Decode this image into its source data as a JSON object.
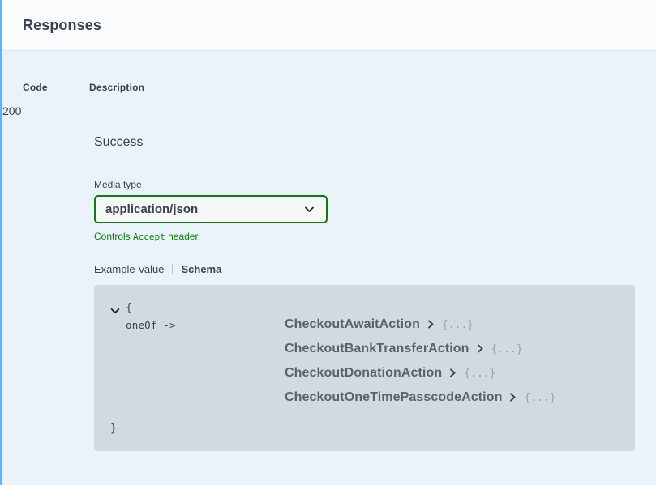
{
  "section": {
    "title": "Responses"
  },
  "table": {
    "headers": {
      "code": "Code",
      "description": "Description"
    },
    "rows": [
      {
        "code": "200",
        "description": "Success"
      }
    ]
  },
  "media_type": {
    "label": "Media type",
    "selected": "application/json",
    "options": [
      "application/json"
    ],
    "hint_prefix": "Controls ",
    "hint_code": "Accept",
    "hint_suffix": " header.",
    "border_color": "#0d7d0d"
  },
  "tabs": {
    "example_value": "Example Value",
    "schema": "Schema",
    "active": "Schema"
  },
  "schema": {
    "open_brace": "{",
    "close_brace": "}",
    "key": "oneOf ->",
    "expand_icon": "chevron-down-icon",
    "items": [
      {
        "name": "CheckoutAwaitAction",
        "chevron": "chevron-right-icon",
        "dots": "{...}"
      },
      {
        "name": "CheckoutBankTransferAction",
        "chevron": "chevron-right-icon",
        "dots": "{...}"
      },
      {
        "name": "CheckoutDonationAction",
        "chevron": "chevron-right-icon",
        "dots": "{...}"
      },
      {
        "name": "CheckoutOneTimePasscodeAction",
        "chevron": "chevron-right-icon",
        "dots": "{...}"
      }
    ]
  },
  "colors": {
    "accent_blue": "#61affe",
    "background": "#ebf3fa",
    "header_bg": "#fbfcfe",
    "model_bg": "#d3d9e0",
    "text": "#3b4151",
    "green": "#0d7d0d"
  }
}
